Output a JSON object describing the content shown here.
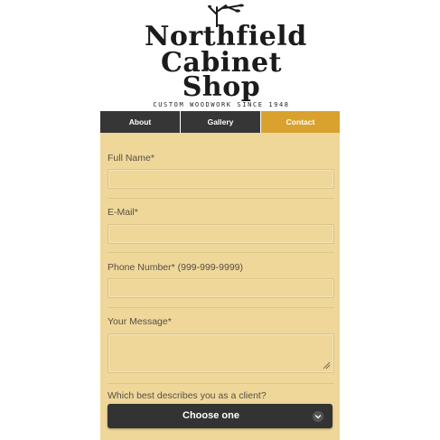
{
  "logo": {
    "line1": "Northfield",
    "line2": "Cabinet",
    "line3": "Shop",
    "tagline": "CUSTOM WOODWORK SINCE 1948"
  },
  "nav": {
    "items": [
      {
        "label": "About"
      },
      {
        "label": "Gallery"
      },
      {
        "label": "Contact"
      }
    ],
    "active": "Contact"
  },
  "form": {
    "full_name": {
      "label": "Full Name*",
      "value": ""
    },
    "email": {
      "label": "E-Mail*",
      "value": ""
    },
    "phone": {
      "label": "Phone Number* (999-999-9999)",
      "value": ""
    },
    "message": {
      "label": "Your Message*",
      "value": ""
    },
    "client_type": {
      "label": "Which best describes you as a client?",
      "selected": "Choose one"
    }
  },
  "colors": {
    "nav_bg": "#363636",
    "nav_active": "#d9a22e",
    "panel_bg": "#efd79a",
    "select_bg": "#333333"
  },
  "icons": [
    "tree-branch-icon",
    "resize-handle-icon",
    "chevron-down-icon"
  ]
}
